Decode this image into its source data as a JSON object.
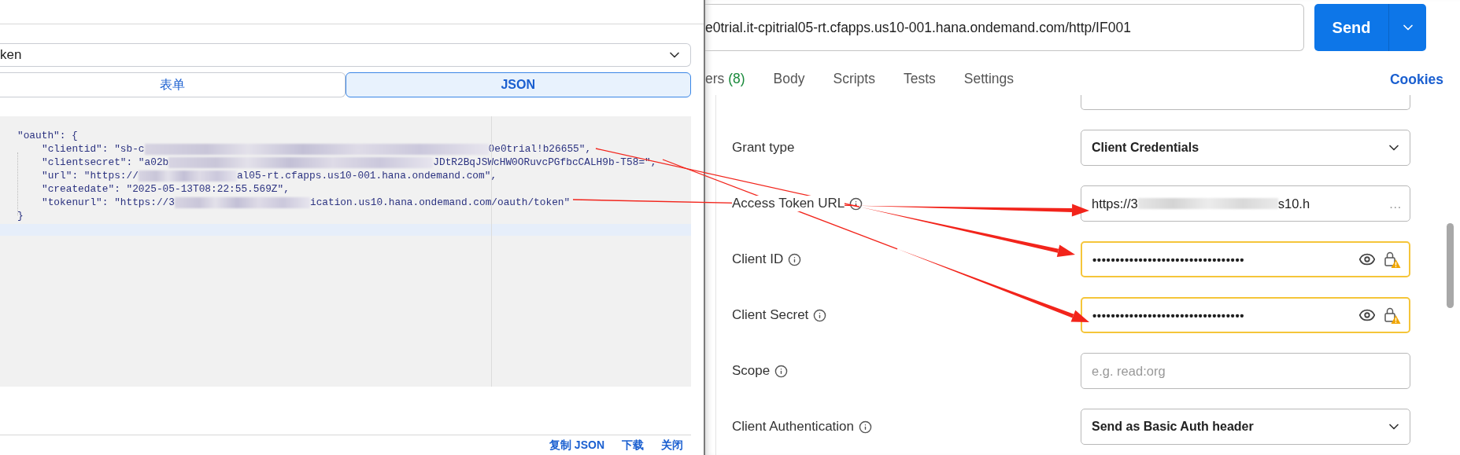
{
  "left_panel": {
    "select_value": "ken",
    "tabs": [
      {
        "label": "表单",
        "selected": false
      },
      {
        "label": "JSON",
        "selected": true
      }
    ],
    "code": {
      "open": "\"oauth\": {",
      "close": "}",
      "children": [
        {
          "start": "\"clientid\": \"sb-c",
          "redacted": true,
          "end": "0e0trial!b26655\","
        },
        {
          "start": "\"clientsecret\": \"a02b",
          "redacted": true,
          "end": "JDtR2BqJSWcHW0ORuvcPGfbcCALH9b-T58=\","
        },
        {
          "start": "\"url\": \"https://",
          "redacted": true,
          "end": "al05-rt.cfapps.us10-001.hana.ondemand.com\","
        },
        {
          "start": "\"createdate\": \"2025-05-13T08:22:55.569Z\",",
          "redacted": false
        },
        {
          "start": "\"tokenurl\": \"https://3",
          "redacted": true,
          "end": "ication.us10.hana.ondemand.com/oauth/token\""
        }
      ]
    },
    "footer_links": [
      "复制 JSON",
      "下载",
      "关闭"
    ]
  },
  "request": {
    "url": "e0trial.it-cpitrial05-rt.cfapps.us10-001.hana.ondemand.com/http/IF001",
    "send_label": "Send",
    "tabs": [
      {
        "label": "ers",
        "badge": "(8)",
        "selected": false
      },
      {
        "label": "Body",
        "selected": false
      },
      {
        "label": "Scripts",
        "selected": false
      },
      {
        "label": "Tests",
        "selected": false
      },
      {
        "label": "Settings",
        "selected": false
      }
    ],
    "cookies": "Cookies",
    "rows": [
      {
        "kind": "partial"
      },
      {
        "kind": "select",
        "label": "Grant type",
        "info": false,
        "value": "Client Credentials"
      },
      {
        "kind": "text",
        "label": "Access Token URL",
        "info": true,
        "value": "https://3",
        "redacted": true,
        "value_end": "s10.h",
        "ellipsis": "…"
      },
      {
        "kind": "secret",
        "label": "Client ID",
        "info": true,
        "value": "•••••••••••••••••••••••••••••••••",
        "warning": true
      },
      {
        "kind": "secret",
        "label": "Client Secret",
        "info": true,
        "value": "•••••••••••••••••••••••••••••••••",
        "warning": true
      },
      {
        "kind": "text",
        "label": "Scope",
        "info": true,
        "placeholder": "e.g. read:org"
      },
      {
        "kind": "select",
        "label": "Client Authentication",
        "info": true,
        "value": "Send as Basic Auth header"
      }
    ]
  }
}
